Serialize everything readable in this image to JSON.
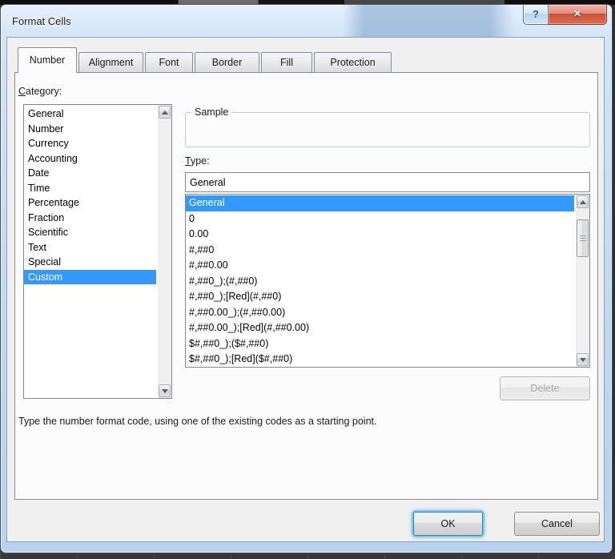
{
  "window": {
    "title": "Format Cells",
    "help_icon": "?",
    "close_icon": "✕"
  },
  "tabs": [
    "Number",
    "Alignment",
    "Font",
    "Border",
    "Fill",
    "Protection"
  ],
  "category": {
    "label_accel": "C",
    "label_rest": "ategory:",
    "items": [
      "General",
      "Number",
      "Currency",
      "Accounting",
      "Date",
      "Time",
      "Percentage",
      "Fraction",
      "Scientific",
      "Text",
      "Special",
      "Custom"
    ],
    "selected": "Custom"
  },
  "sample": {
    "label": "Sample"
  },
  "type": {
    "label_accel": "T",
    "label_rest": "ype:",
    "value": "General",
    "items": [
      "General",
      "0",
      "0.00",
      "#,##0",
      "#,##0.00",
      "#,##0_);(#,##0)",
      "#,##0_);[Red](#,##0)",
      "#,##0.00_);(#,##0.00)",
      "#,##0.00_);[Red](#,##0.00)",
      "$#,##0_);($#,##0)",
      "$#,##0_);[Red]($#,##0)"
    ],
    "selected": "General"
  },
  "hint": "Type the number format code, using one of the existing codes as a starting point.",
  "buttons": {
    "delete": "Delete",
    "ok": "OK",
    "cancel": "Cancel"
  },
  "colors": {
    "selection": "#3399ff",
    "close_red": "#c94f3a",
    "titlebar_blue": "#d2e4f7",
    "dialog_bg": "#f0f0f0"
  }
}
